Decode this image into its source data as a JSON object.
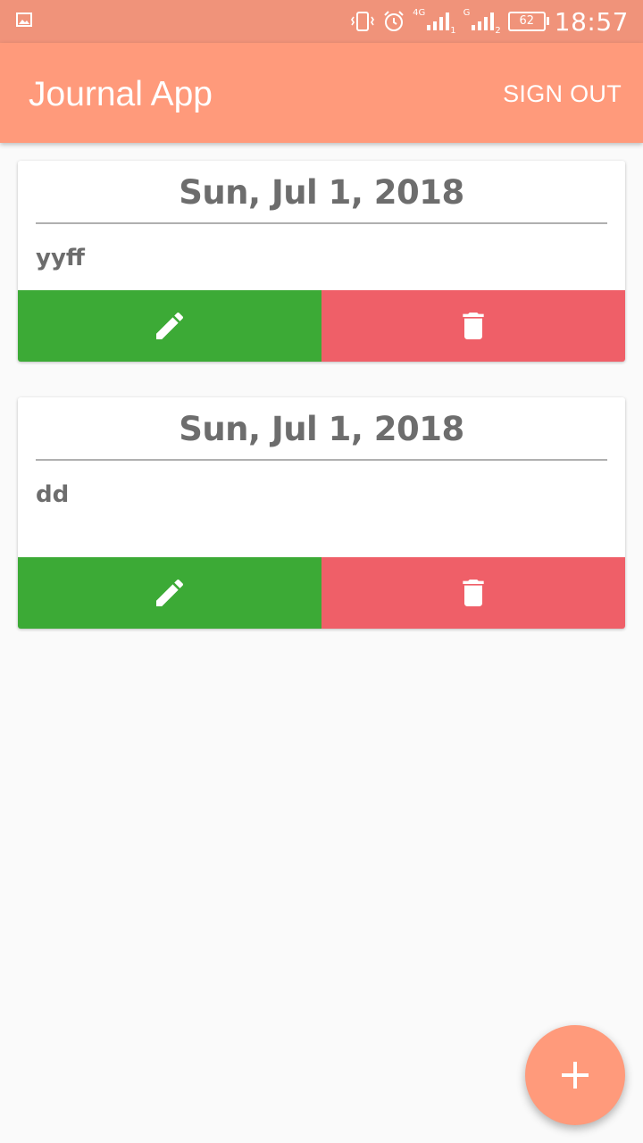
{
  "status_bar": {
    "time": "18:57",
    "battery": "62",
    "sim1_label": "4G",
    "sim1_index": "1",
    "sim2_label": "G",
    "sim2_index": "2",
    "icons": [
      "image-icon",
      "vibrate-icon",
      "alarm-icon",
      "signal-icon",
      "signal-icon",
      "battery-icon"
    ]
  },
  "app_bar": {
    "title": "Journal App",
    "sign_out_label": "SIGN OUT"
  },
  "entries": [
    {
      "date": "Sun, Jul 1, 2018",
      "text": "yyff"
    },
    {
      "date": "Sun, Jul 1, 2018",
      "text": "dd"
    }
  ],
  "icons": {
    "edit": "pencil-icon",
    "delete": "trash-icon",
    "add": "plus-icon"
  },
  "colors": {
    "primary": "#ff9a7b",
    "status_bar": "#f0937a",
    "edit": "#3caa36",
    "delete": "#ef5f68",
    "text": "#6d6d6d"
  }
}
